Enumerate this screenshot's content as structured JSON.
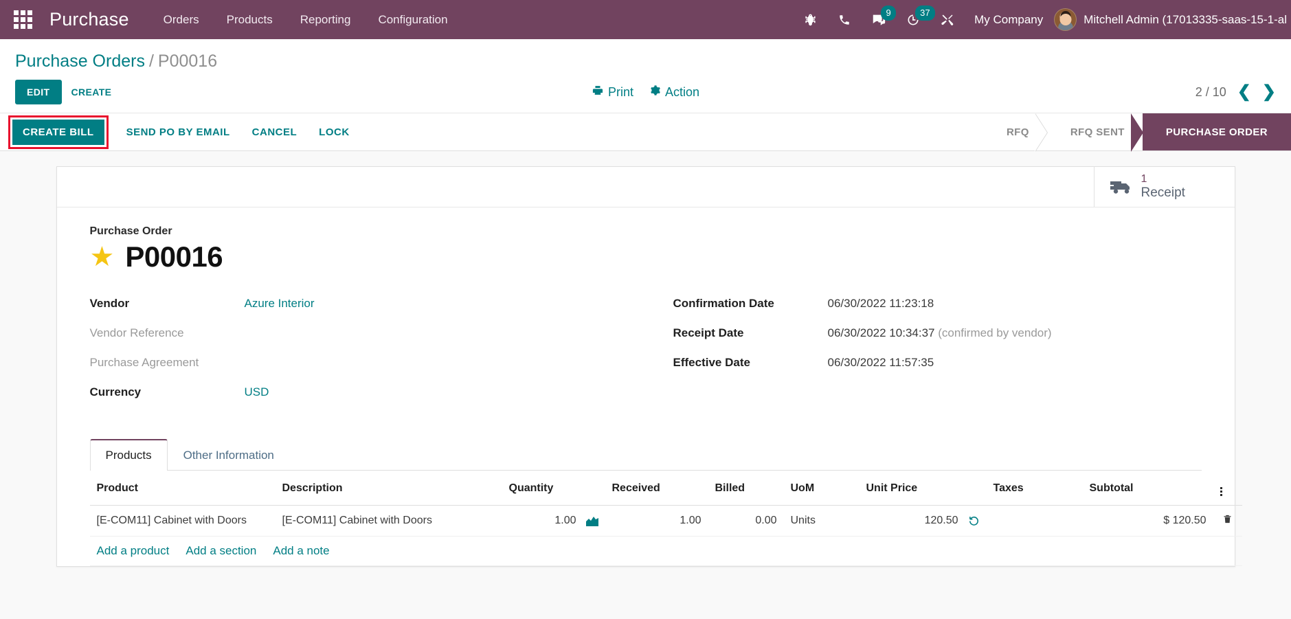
{
  "navbar": {
    "apps_icon": "apps-grid-icon",
    "brand": "Purchase",
    "menu": [
      {
        "label": "Orders"
      },
      {
        "label": "Products"
      },
      {
        "label": "Reporting"
      },
      {
        "label": "Configuration"
      }
    ],
    "icons": [
      {
        "name": "bug-icon",
        "badge": ""
      },
      {
        "name": "phone-icon",
        "badge": ""
      },
      {
        "name": "messages-icon",
        "badge": "9"
      },
      {
        "name": "activities-clock-icon",
        "badge": "37"
      },
      {
        "name": "tools-wrench-icon",
        "badge": ""
      }
    ],
    "company": "My Company",
    "user": "Mitchell Admin (17013335-saas-15-1-al",
    "accent": "#71435f",
    "badge_color": "#017e84"
  },
  "breadcrumb": {
    "parent": "Purchase Orders",
    "separator": "/",
    "current": "P00016"
  },
  "control_panel": {
    "edit_label": "EDIT",
    "create_label": "CREATE",
    "print_label": "Print",
    "action_label": "Action",
    "pager_value": "2 / 10",
    "prev_icon": "chevron-left-icon",
    "next_icon": "chevron-right-icon"
  },
  "statusbar": {
    "buttons": [
      {
        "label": "CREATE BILL",
        "style": "primary",
        "highlighted": true
      },
      {
        "label": "SEND PO BY EMAIL",
        "style": "link"
      },
      {
        "label": "CANCEL",
        "style": "link"
      },
      {
        "label": "LOCK",
        "style": "link"
      }
    ],
    "highlight_color": "#e8112d",
    "stages": [
      {
        "label": "RFQ",
        "active": false
      },
      {
        "label": "RFQ SENT",
        "active": false
      },
      {
        "label": "PURCHASE ORDER",
        "active": true
      }
    ]
  },
  "smart_buttons": [
    {
      "icon": "truck-icon",
      "value": "1",
      "label": "Receipt"
    }
  ],
  "record": {
    "title_label": "Purchase Order",
    "star_icon": "star-icon",
    "name": "P00016"
  },
  "form": {
    "left": [
      {
        "label": "Vendor",
        "value": "Azure Interior",
        "empty": false,
        "link": true
      },
      {
        "label": "Vendor Reference",
        "value": "",
        "empty": true,
        "link": false
      },
      {
        "label": "Purchase Agreement",
        "value": "",
        "empty": true,
        "link": false
      },
      {
        "label": "Currency",
        "value": "USD",
        "empty": false,
        "link": true
      }
    ],
    "right": [
      {
        "label": "Confirmation Date",
        "value": "06/30/2022 11:23:18",
        "note": ""
      },
      {
        "label": "Receipt Date",
        "value": "06/30/2022 10:34:37",
        "note": "(confirmed by vendor)"
      },
      {
        "label": "Effective Date",
        "value": "06/30/2022 11:57:35",
        "note": ""
      }
    ]
  },
  "notebook": {
    "tabs": [
      {
        "label": "Products",
        "active": true
      },
      {
        "label": "Other Information",
        "active": false
      }
    ],
    "table": {
      "columns": [
        "Product",
        "Description",
        "Quantity",
        "Received",
        "Billed",
        "UoM",
        "Unit Price",
        "Taxes",
        "Subtotal"
      ],
      "optional_columns_icon": "vertical-dots-icon",
      "rows": [
        {
          "product": "[E-COM11] Cabinet with Doors",
          "description": "[E-COM11] Cabinet with Doors",
          "quantity": "1.00",
          "quantity_icon": "forecast-chart-icon",
          "received": "1.00",
          "billed": "0.00",
          "uom": "Units",
          "unit_price": "120.50",
          "unit_price_icon": "price-history-icon",
          "taxes": "",
          "subtotal": "$ 120.50",
          "delete_icon": "trash-icon"
        }
      ],
      "add_links": [
        {
          "label": "Add a product"
        },
        {
          "label": "Add a section"
        },
        {
          "label": "Add a note"
        }
      ]
    }
  }
}
